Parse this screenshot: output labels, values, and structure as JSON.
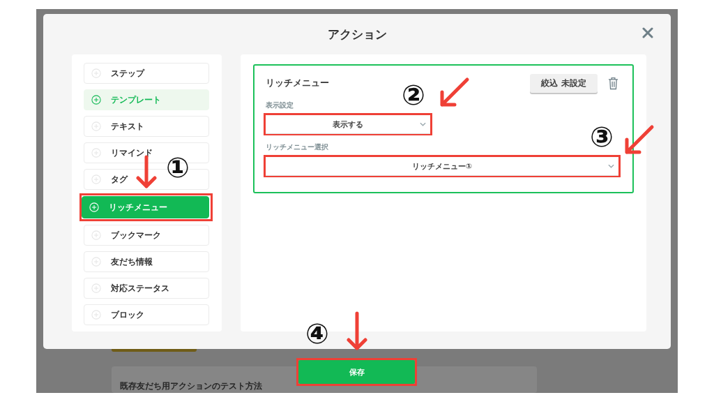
{
  "modal": {
    "title": "アクション"
  },
  "sidebar": {
    "items": [
      {
        "label": "ステップ",
        "selected": false,
        "hovered": false,
        "highlighted": false
      },
      {
        "label": "テンプレート",
        "selected": false,
        "hovered": true,
        "highlighted": false
      },
      {
        "label": "テキスト",
        "selected": false,
        "hovered": false,
        "highlighted": false
      },
      {
        "label": "リマインド",
        "selected": false,
        "hovered": false,
        "highlighted": false
      },
      {
        "label": "タグ",
        "selected": false,
        "hovered": false,
        "highlighted": false
      },
      {
        "label": "リッチメニュー",
        "selected": true,
        "hovered": false,
        "highlighted": true
      },
      {
        "label": "ブックマーク",
        "selected": false,
        "hovered": false,
        "highlighted": false
      },
      {
        "label": "友だち情報",
        "selected": false,
        "hovered": false,
        "highlighted": false
      },
      {
        "label": "対応ステータス",
        "selected": false,
        "hovered": false,
        "highlighted": false
      },
      {
        "label": "ブロック",
        "selected": false,
        "hovered": false,
        "highlighted": false
      }
    ]
  },
  "action_card": {
    "title": "リッチメニュー",
    "filter_button": "絞込 未設定",
    "fields": [
      {
        "label": "表示設定",
        "value": "表示する",
        "highlighted": true
      },
      {
        "label": "リッチメニュー選択",
        "value": "リッチメニュー①",
        "highlighted": true
      }
    ]
  },
  "save_button": {
    "label": "保存",
    "highlighted": true
  },
  "background": {
    "guide_title": "既存友だち用アクションのテスト方法"
  },
  "annotations": [
    {
      "label": "①"
    },
    {
      "label": "②"
    },
    {
      "label": "③"
    },
    {
      "label": "④"
    }
  ]
}
